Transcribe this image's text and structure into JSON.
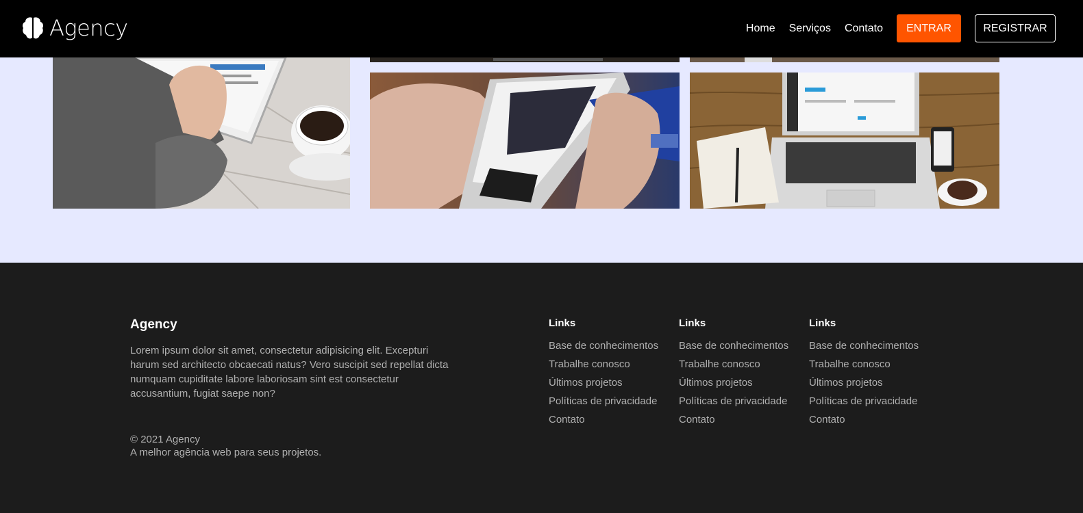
{
  "header": {
    "brand": "Agency",
    "nav": [
      {
        "label": "Home"
      },
      {
        "label": "Serviços"
      },
      {
        "label": "Contato"
      }
    ],
    "login_label": "ENTRAR",
    "register_label": "REGISTRAR"
  },
  "colors": {
    "accent": "#ff5500",
    "header_bg": "#000000",
    "gallery_bg": "#e6e9ff",
    "footer_bg": "#1c1c1c"
  },
  "footer": {
    "brand": "Agency",
    "description": "Lorem ipsum dolor sit amet, consectetur adipisicing elit. Excepturi harum sed architecto obcaecati natus? Vero suscipit sed repellat dicta numquam cupiditate labore laboriosam sint est consectetur accusantium, fugiat saepe non?",
    "copyright": "© 2021 Agency",
    "tagline": "A melhor agência web para seus projetos.",
    "columns": [
      {
        "title": "Links",
        "links": [
          "Base de conhecimentos",
          "Trabalhe conosco",
          "Últimos projetos",
          "Políticas de privacidade",
          "Contato"
        ]
      },
      {
        "title": "Links",
        "links": [
          "Base de conhecimentos",
          "Trabalhe conosco",
          "Últimos projetos",
          "Políticas de privacidade",
          "Contato"
        ]
      },
      {
        "title": "Links",
        "links": [
          "Base de conhecimentos",
          "Trabalhe conosco",
          "Últimos projetos",
          "Políticas de privacidade",
          "Contato"
        ]
      }
    ]
  }
}
